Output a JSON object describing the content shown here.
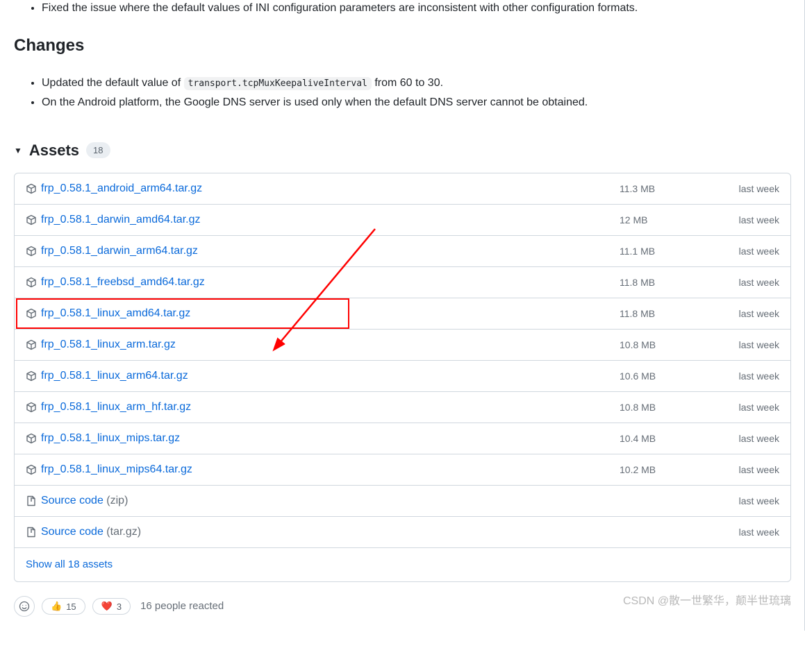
{
  "release_body": {
    "fixes_item": "Fixed the issue where the default values of INI configuration parameters are inconsistent with other configuration formats.",
    "changes_heading": "Changes",
    "changes_items": [
      {
        "pre": "Updated the default value of ",
        "code": "transport.tcpMuxKeepaliveInterval",
        "post": " from 60 to 30."
      },
      {
        "pre": "On the Android platform, the Google DNS server is used only when the default DNS server cannot be obtained.",
        "code": "",
        "post": ""
      }
    ]
  },
  "assets": {
    "title": "Assets",
    "count": "18",
    "show_all": "Show all 18 assets",
    "items": [
      {
        "name": "frp_0.58.1_android_arm64.tar.gz",
        "size": "11.3 MB",
        "date": "last week",
        "icon": "package",
        "hl": false
      },
      {
        "name": "frp_0.58.1_darwin_amd64.tar.gz",
        "size": "12 MB",
        "date": "last week",
        "icon": "package",
        "hl": false
      },
      {
        "name": "frp_0.58.1_darwin_arm64.tar.gz",
        "size": "11.1 MB",
        "date": "last week",
        "icon": "package",
        "hl": false
      },
      {
        "name": "frp_0.58.1_freebsd_amd64.tar.gz",
        "size": "11.8 MB",
        "date": "last week",
        "icon": "package",
        "hl": false
      },
      {
        "name": "frp_0.58.1_linux_amd64.tar.gz",
        "size": "11.8 MB",
        "date": "last week",
        "icon": "package",
        "hl": true
      },
      {
        "name": "frp_0.58.1_linux_arm.tar.gz",
        "size": "10.8 MB",
        "date": "last week",
        "icon": "package",
        "hl": false
      },
      {
        "name": "frp_0.58.1_linux_arm64.tar.gz",
        "size": "10.6 MB",
        "date": "last week",
        "icon": "package",
        "hl": false
      },
      {
        "name": "frp_0.58.1_linux_arm_hf.tar.gz",
        "size": "10.8 MB",
        "date": "last week",
        "icon": "package",
        "hl": false
      },
      {
        "name": "frp_0.58.1_linux_mips.tar.gz",
        "size": "10.4 MB",
        "date": "last week",
        "icon": "package",
        "hl": false
      },
      {
        "name": "frp_0.58.1_linux_mips64.tar.gz",
        "size": "10.2 MB",
        "date": "last week",
        "icon": "package",
        "hl": false
      },
      {
        "name": "Source code",
        "suffix": " (zip)",
        "size": "",
        "date": "last week",
        "icon": "zip",
        "hl": false
      },
      {
        "name": "Source code",
        "suffix": " (tar.gz)",
        "size": "",
        "date": "last week",
        "icon": "zip",
        "hl": false
      }
    ]
  },
  "reactions": {
    "thumbs": {
      "emoji": "👍",
      "count": "15"
    },
    "heart": {
      "emoji": "❤️",
      "count": "3"
    },
    "summary": "16 people reacted"
  },
  "watermark": "CSDN @散一世繁华，颠半世琉璃"
}
